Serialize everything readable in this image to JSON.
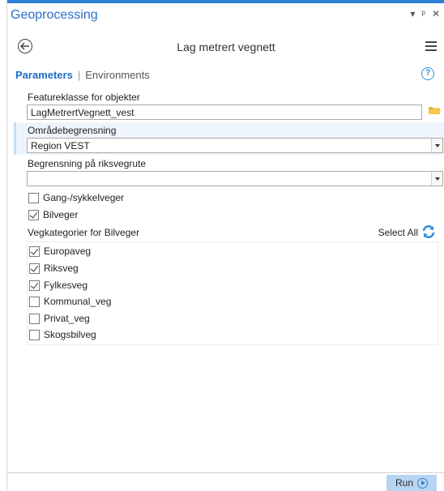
{
  "pane": {
    "title": "Geoprocessing",
    "controls": [
      "▾",
      "ᵖ",
      "✕"
    ]
  },
  "tool": {
    "title": "Lag metrert vegnett"
  },
  "tabs": {
    "parameters": "Parameters",
    "separator": "|",
    "environments": "Environments",
    "help_glyph": "?"
  },
  "params": {
    "featureklasse_label": "Featureklasse for objekter",
    "featureklasse_value": "LagMetrertVegnett_vest",
    "omrade_label": "Områdebegrensning",
    "omrade_value": "Region VEST",
    "riksveg_label": "Begrensning på riksvegrute",
    "riksveg_value": "",
    "gang_label": "Gang-/sykkelveger",
    "gang_checked": false,
    "bil_label": "Bilveger",
    "bil_checked": true
  },
  "vegkategorier": {
    "label": "Vegkategorier for Bilveger",
    "select_all": "Select All",
    "items": [
      {
        "label": "Europaveg",
        "checked": true
      },
      {
        "label": "Riksveg",
        "checked": true
      },
      {
        "label": "Fylkesveg",
        "checked": true
      },
      {
        "label": "Kommunal_veg",
        "checked": false
      },
      {
        "label": "Privat_veg",
        "checked": false
      },
      {
        "label": "Skogsbilveg",
        "checked": false
      }
    ]
  },
  "footer": {
    "run_label": "Run"
  },
  "colors": {
    "accent": "#2a6fc9",
    "run_button": "#b7d5f2",
    "folder": "#e8b83a"
  }
}
